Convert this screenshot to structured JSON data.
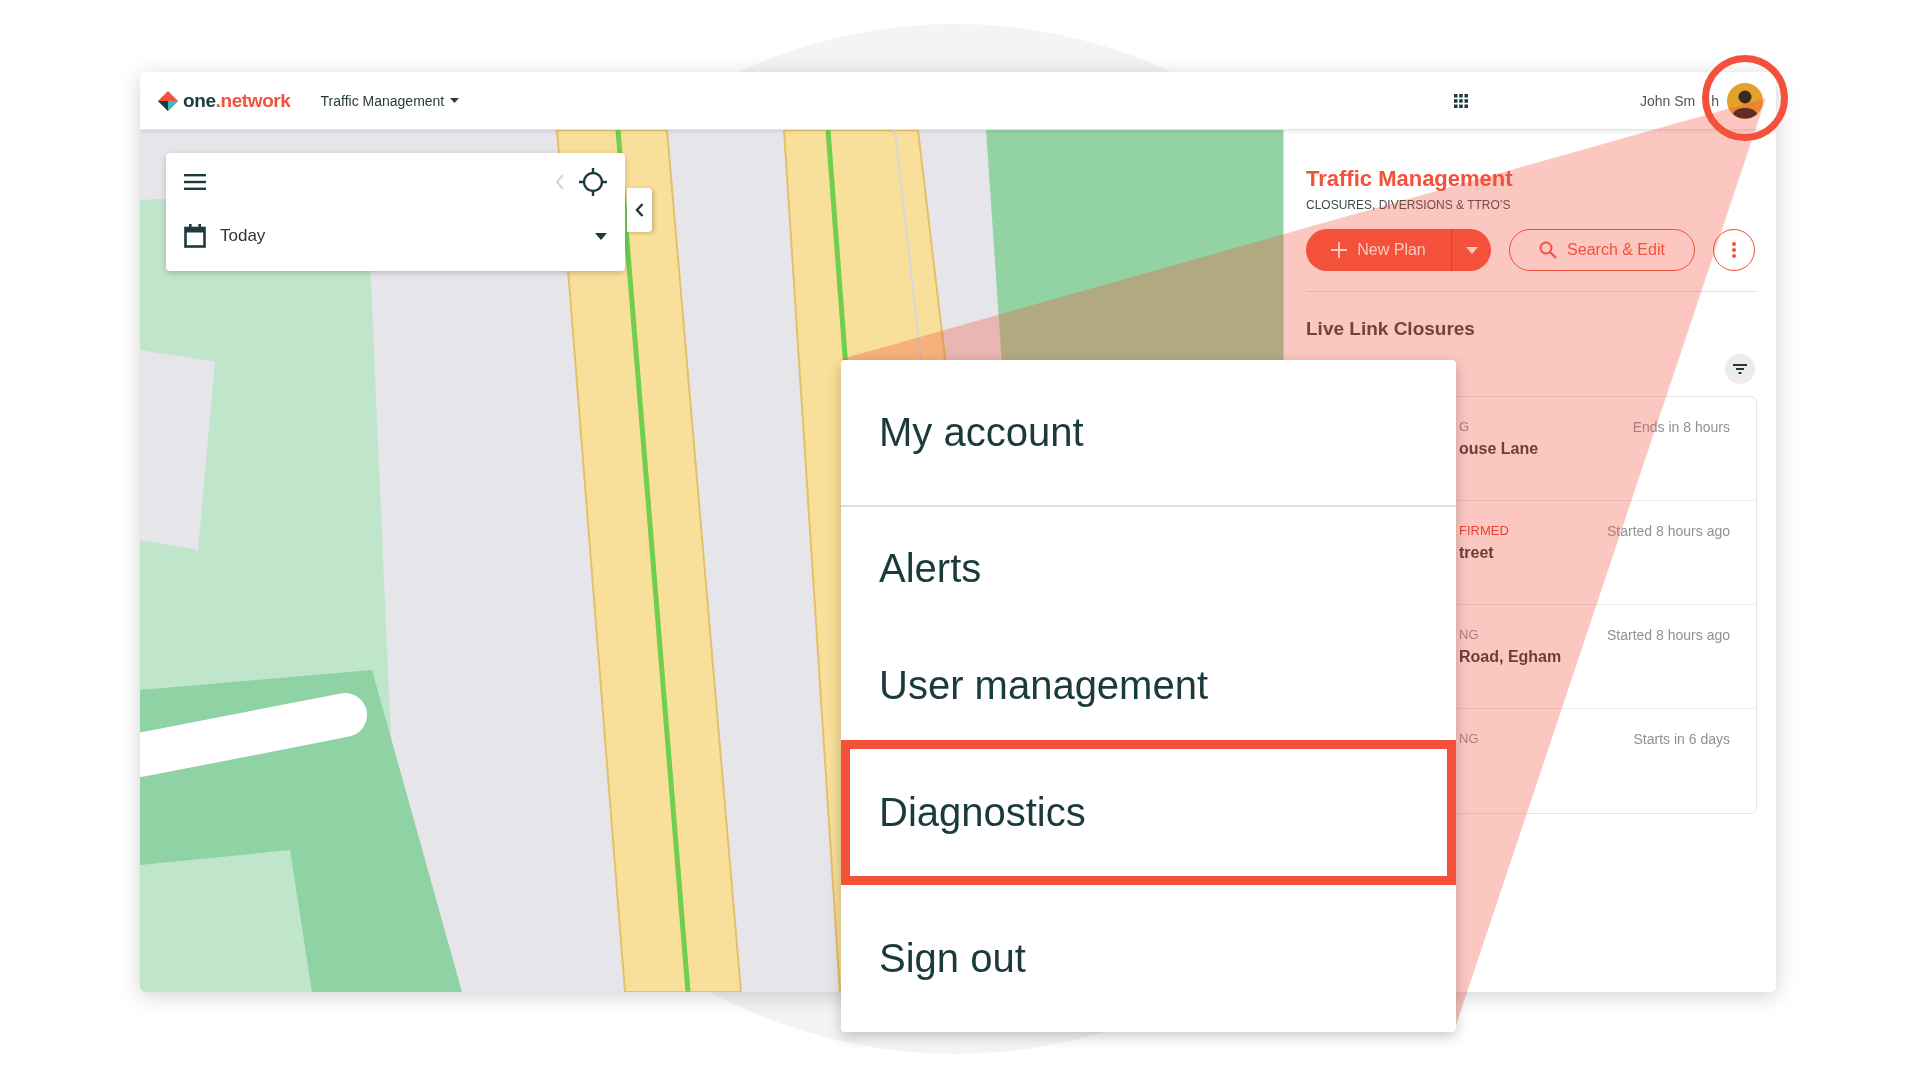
{
  "header": {
    "logo": {
      "prefix": "one",
      "suffix": ".network"
    },
    "app_menu": {
      "label": "Traffic Management"
    },
    "user": {
      "name_parts": [
        "John Sm",
        "h"
      ]
    }
  },
  "map_controls": {
    "back_disabled": true,
    "date_filter": {
      "value": "Today"
    }
  },
  "panel": {
    "title": "Traffic Management",
    "subtitle": "CLOSURES, DIVERSIONS & TTRO’S",
    "buttons": [
      {
        "kind": "split",
        "label": "New Plan"
      },
      {
        "kind": "outline",
        "label": "Search & Edit"
      },
      {
        "kind": "more"
      }
    ],
    "section_title": "Live Link Closures",
    "closures": [
      {
        "kind": "normal",
        "status": "G",
        "location": "ouse Lane",
        "time": "Ends in 8 hours"
      },
      {
        "kind": "alert",
        "status": "FIRMED",
        "location": "treet",
        "time": "Started 8 hours ago"
      },
      {
        "kind": "normal",
        "status": "NG",
        "location": "Road, Egham",
        "time": "Started 8 hours ago"
      },
      {
        "kind": "normal",
        "status": "NG",
        "time": "Starts in 6 days"
      }
    ]
  },
  "account_menu": {
    "items": [
      {
        "label": "My account",
        "divider_after": true,
        "highlighted": false
      },
      {
        "label": "Alerts",
        "divider_after": false,
        "highlighted": false
      },
      {
        "label": "User management",
        "divider_after": false,
        "highlighted": false
      },
      {
        "label": "Diagnostics",
        "divider_after": false,
        "highlighted": true
      },
      {
        "label": "Sign out",
        "divider_after": false,
        "highlighted": false
      }
    ]
  }
}
